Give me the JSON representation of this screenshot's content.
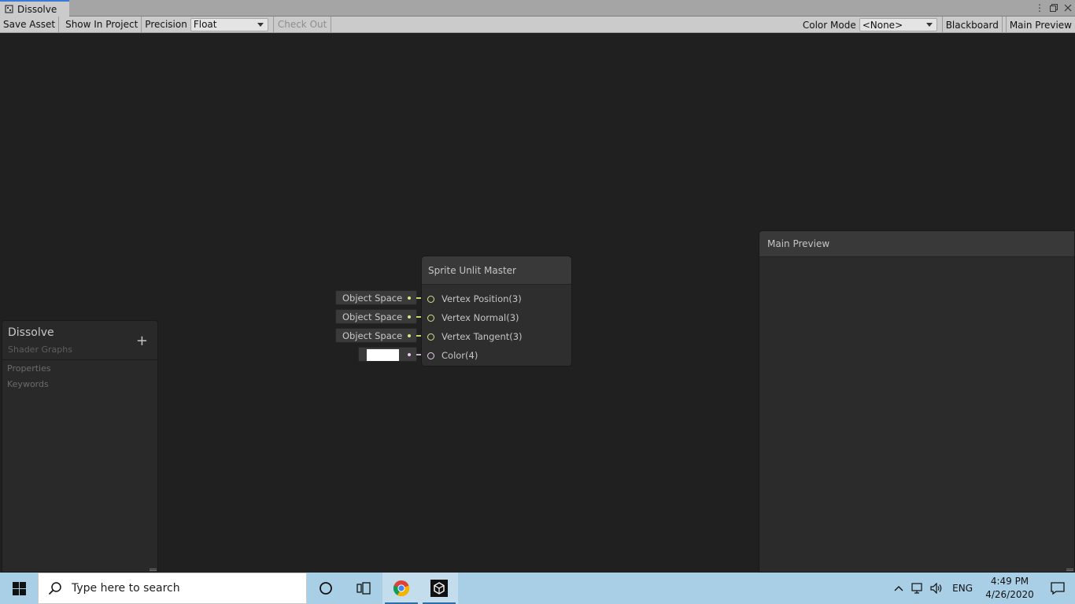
{
  "window": {
    "tab_title": "Dissolve"
  },
  "toolbar": {
    "save_asset": "Save Asset",
    "show_in_project": "Show In Project",
    "precision_label": "Precision",
    "precision_value": "Float",
    "check_out": "Check Out",
    "color_mode_label": "Color Mode",
    "color_mode_value": "<None>",
    "blackboard": "Blackboard",
    "main_preview": "Main Preview"
  },
  "blackboard": {
    "title": "Dissolve",
    "subtitle": "Shader Graphs",
    "add_symbol": "+",
    "items": [
      "Properties",
      "Keywords"
    ]
  },
  "master_node": {
    "title": "Sprite Unlit Master",
    "ports": [
      {
        "label": "Vertex Position(3)",
        "input": "Object Space"
      },
      {
        "label": "Vertex Normal(3)",
        "input": "Object Space"
      },
      {
        "label": "Vertex Tangent(3)",
        "input": "Object Space"
      },
      {
        "label": "Color(4)",
        "input": ""
      }
    ],
    "color_input_value": "#ffffff",
    "port_color": "#d7e088",
    "color_port_color": "#e8cfe8"
  },
  "preview": {
    "title": "Main Preview"
  },
  "taskbar": {
    "search_placeholder": "Type here to search",
    "language": "ENG",
    "time": "4:49 PM",
    "date": "4/26/2020",
    "accent": "#a9cfe6"
  }
}
